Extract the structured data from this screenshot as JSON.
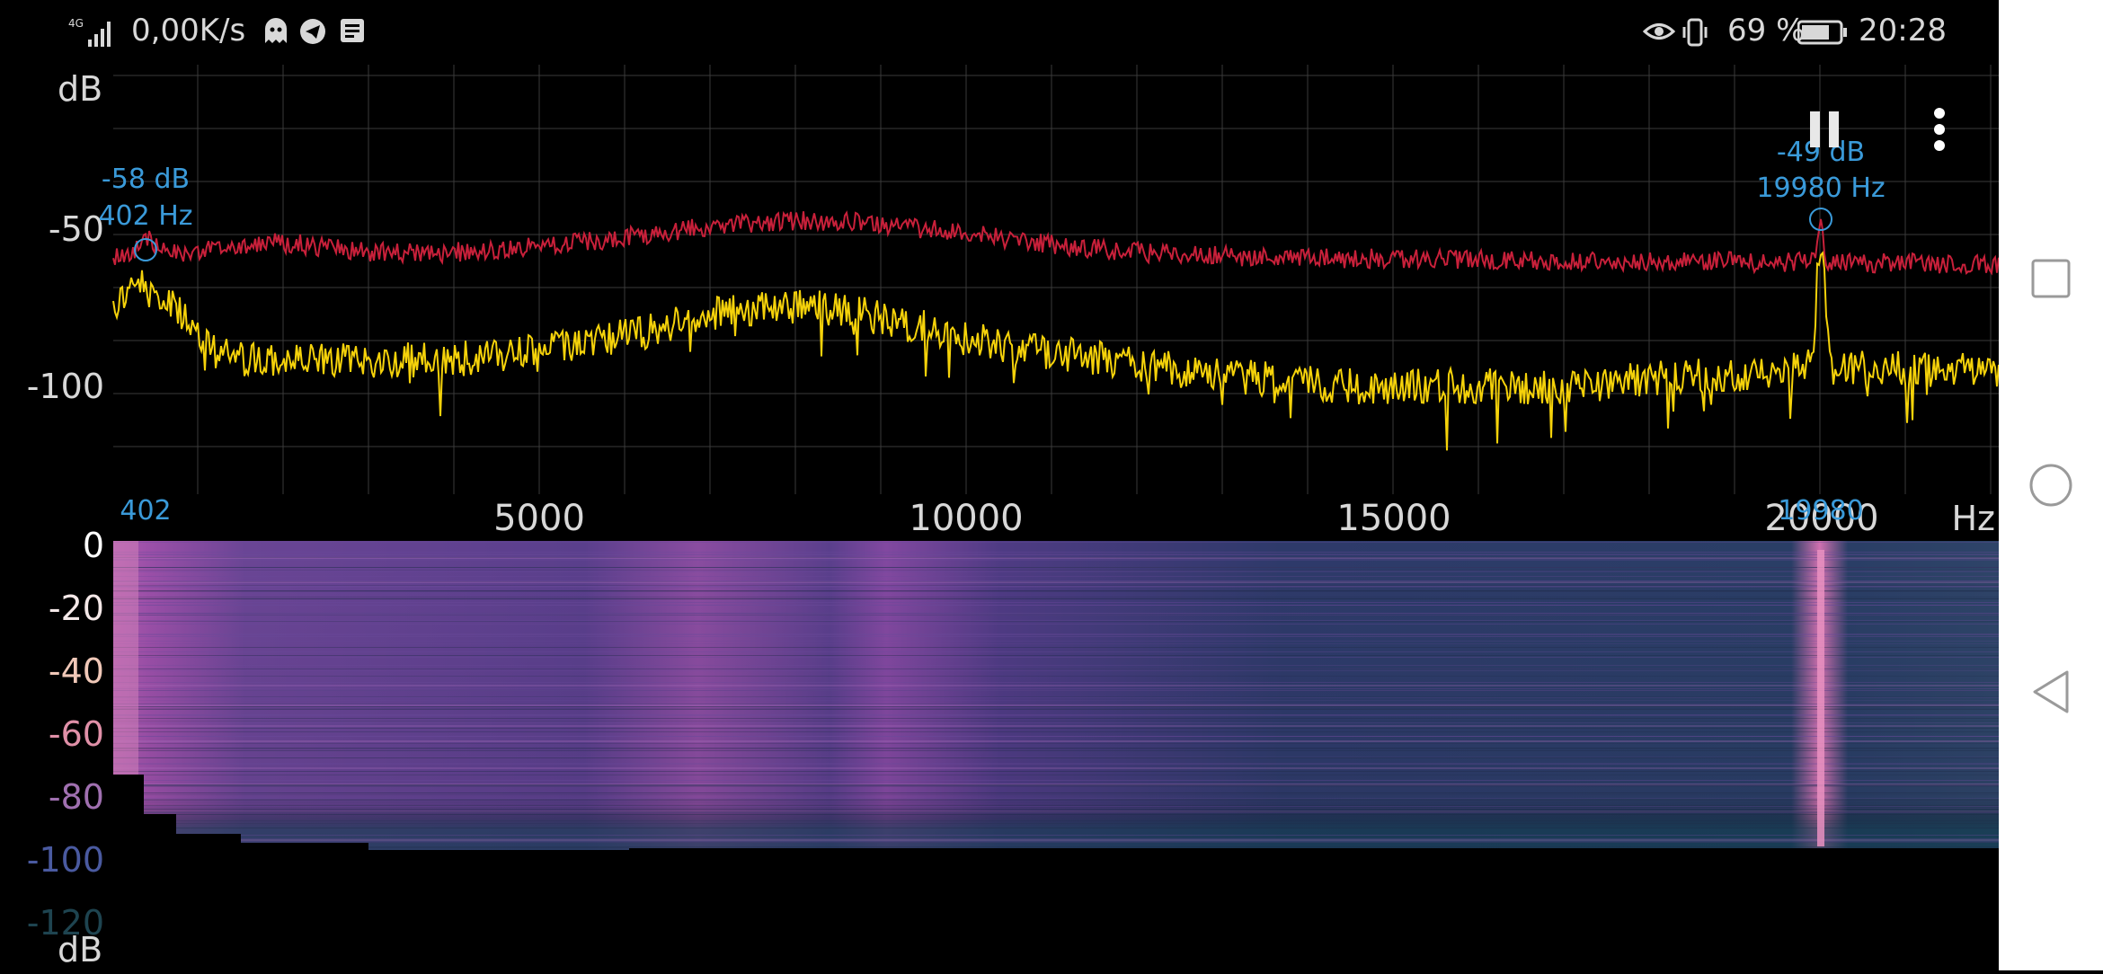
{
  "status_bar": {
    "network_type": "4G",
    "net_speed": "0,00K/s",
    "battery_percent": "69 %",
    "time": "20:28",
    "icons": [
      "signal-icon",
      "ghost-icon",
      "telegram-icon",
      "news-icon",
      "eye-icon",
      "vibrate-icon",
      "battery-icon"
    ]
  },
  "spectrum": {
    "y_unit": "dB",
    "y_ticks": [
      "-50",
      "-100"
    ],
    "x_unit": "Hz",
    "x_ticks": [
      "5000",
      "10000",
      "15000",
      "20000"
    ],
    "peak_left": {
      "db": "-58 dB",
      "hz": "402 Hz",
      "axis_marker": "402"
    },
    "peak_right": {
      "db": "-49 dB",
      "hz": "19980 Hz",
      "axis_marker": "19980"
    },
    "colors": {
      "peak_hold": "#c8203a",
      "current": "#f5d20a",
      "marker_text": "#3a9ad9",
      "grid": "#3a3a3a"
    }
  },
  "spectrogram": {
    "y_unit": "dB",
    "scale_ticks": [
      "0",
      "-20",
      "-40",
      "-60",
      "-80",
      "-100",
      "-120"
    ]
  },
  "controls": {
    "pause_icon": "pause-icon",
    "menu_icon": "more-vertical-icon"
  },
  "navigation": {
    "icons": [
      "recent-apps-icon",
      "home-icon",
      "back-icon"
    ]
  }
}
